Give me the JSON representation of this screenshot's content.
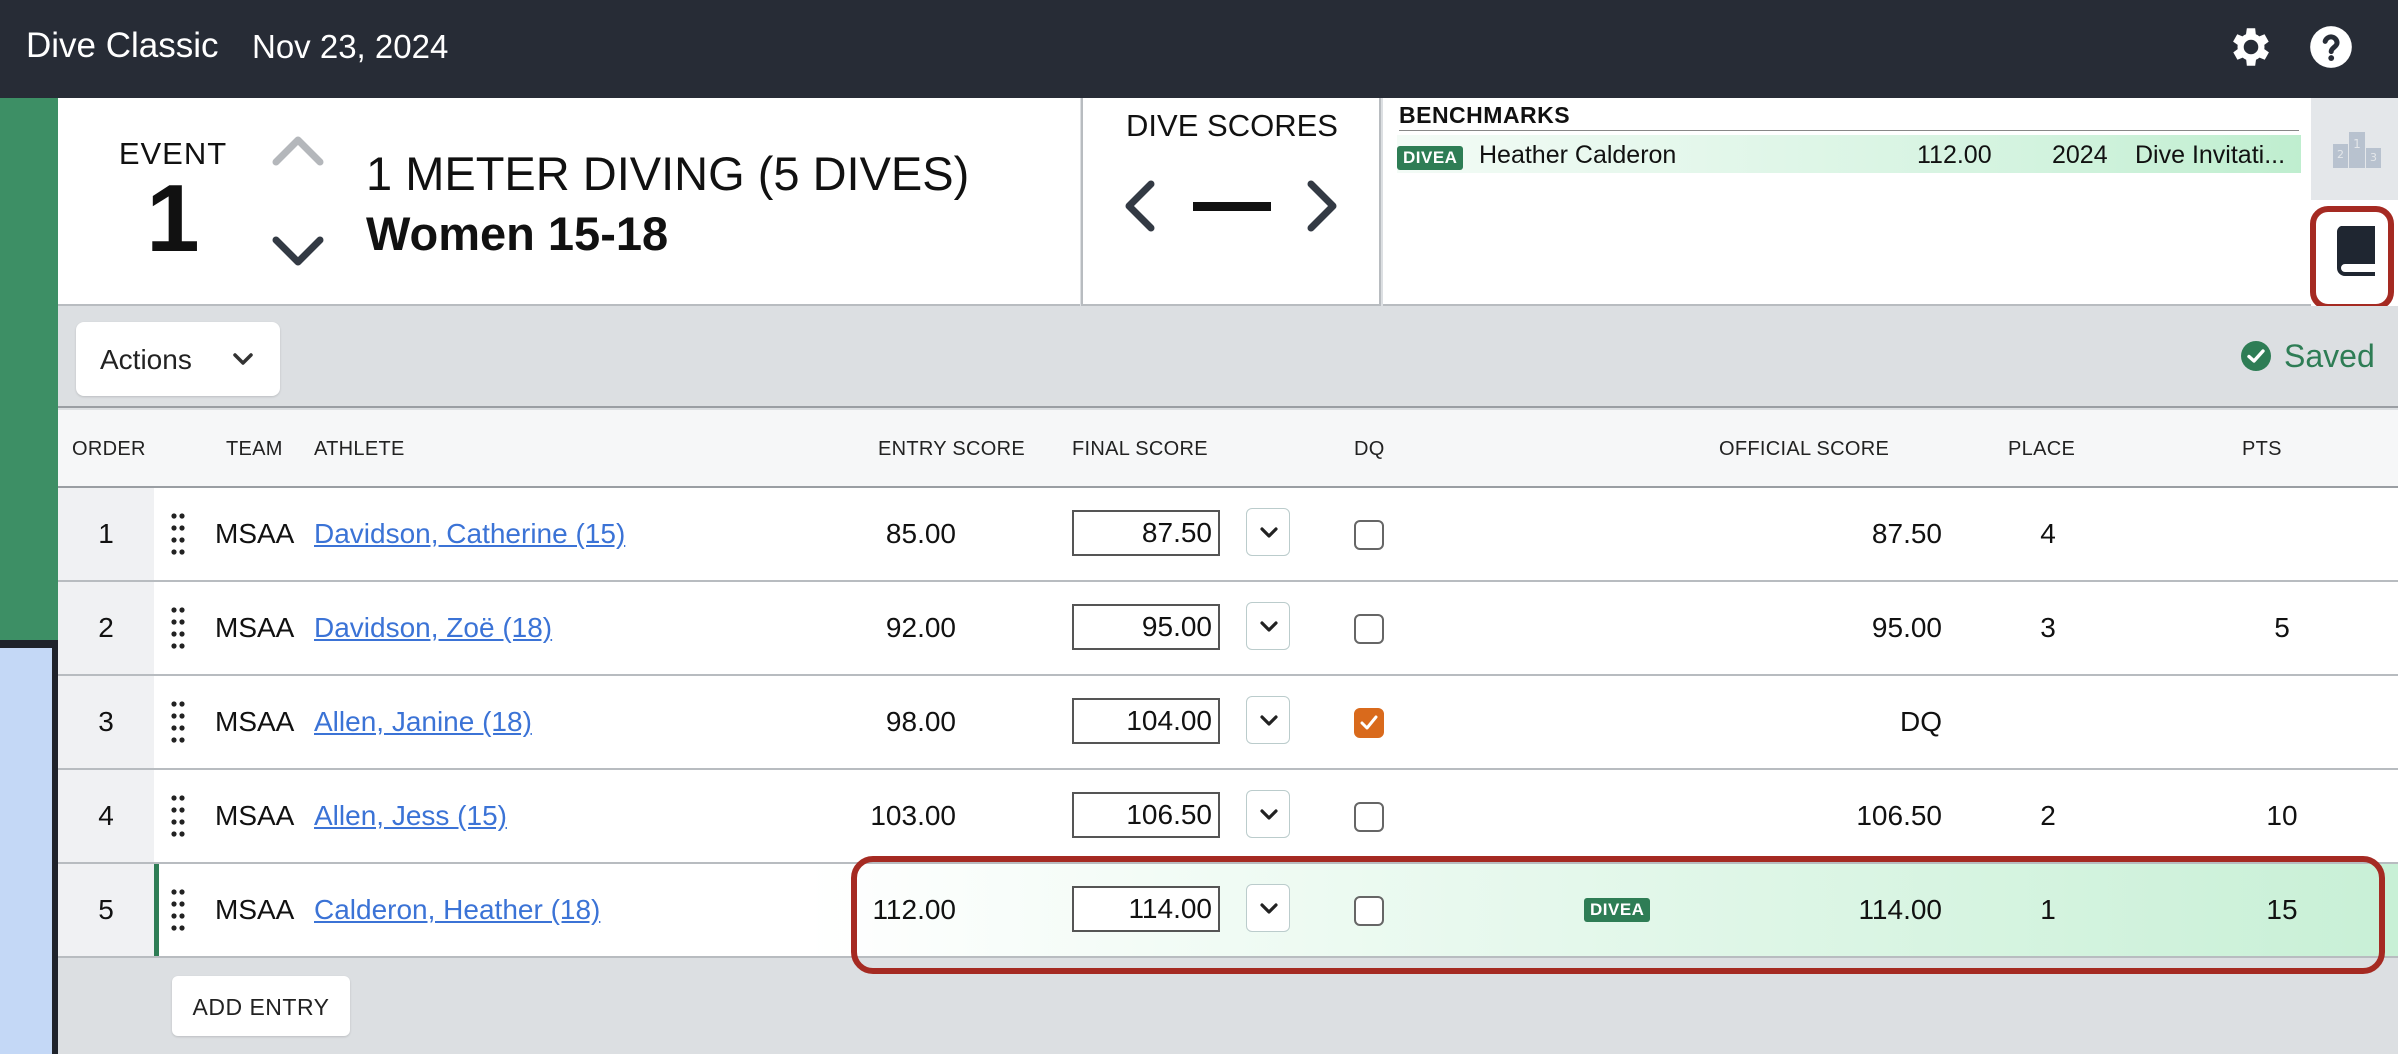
{
  "app": {
    "title": "Dive Classic",
    "date": "Nov 23, 2024"
  },
  "topbar_icons": {
    "settings": "gear-icon",
    "help": "question-circle-icon"
  },
  "event": {
    "label": "EVENT",
    "number": "1",
    "title": "1 METER DIVING (5 DIVES)",
    "subtitle": "Women 15-18"
  },
  "dive_scores": {
    "label": "DIVE SCORES",
    "value": "—"
  },
  "benchmarks": {
    "label": "BENCHMARKS",
    "items": [
      {
        "badge": "DIVEA",
        "name": "Heather Calderon",
        "score": "112.00",
        "year": "2024",
        "meet": "Dive Invitati..."
      }
    ]
  },
  "side_tabs": {
    "podium": "podium-icon",
    "book": "book-icon"
  },
  "toolbar": {
    "actions_label": "Actions",
    "saved_label": "Saved"
  },
  "table": {
    "headers": {
      "order": "ORDER",
      "team": "TEAM",
      "athlete": "ATHLETE",
      "entry_score": "ENTRY SCORE",
      "final_score": "FINAL SCORE",
      "dq": "DQ",
      "official_score": "OFFICIAL SCORE",
      "place": "PLACE",
      "pts": "PTS"
    },
    "rows": [
      {
        "order": "1",
        "team": "MSAA",
        "athlete": "Davidson, Catherine (15)",
        "entry": "85.00",
        "final": "87.50",
        "dq": false,
        "badge": "",
        "official": "87.50",
        "place": "4",
        "pts": ""
      },
      {
        "order": "2",
        "team": "MSAA",
        "athlete": "Davidson, Zoë (18)",
        "entry": "92.00",
        "final": "95.00",
        "dq": false,
        "badge": "",
        "official": "95.00",
        "place": "3",
        "pts": "5"
      },
      {
        "order": "3",
        "team": "MSAA",
        "athlete": "Allen, Janine (18)",
        "entry": "98.00",
        "final": "104.00",
        "dq": true,
        "badge": "",
        "official": "DQ",
        "place": "",
        "pts": ""
      },
      {
        "order": "4",
        "team": "MSAA",
        "athlete": "Allen, Jess (15)",
        "entry": "103.00",
        "final": "106.50",
        "dq": false,
        "badge": "",
        "official": "106.50",
        "place": "2",
        "pts": "10"
      },
      {
        "order": "5",
        "team": "MSAA",
        "athlete": "Calderon, Heather (18)",
        "entry": "112.00",
        "final": "114.00",
        "dq": false,
        "badge": "DIVEA",
        "official": "114.00",
        "place": "1",
        "pts": "15"
      }
    ],
    "add_entry_label": "ADD ENTRY"
  },
  "colors": {
    "accent_green": "#2e7d55",
    "highlight_red": "#a52a22",
    "link_blue": "#3b73d6",
    "dq_orange": "#d96a1c"
  }
}
